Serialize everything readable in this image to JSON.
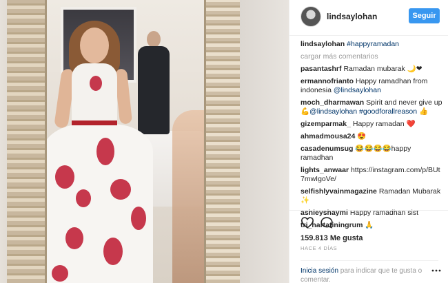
{
  "post": {
    "username": "lindsaylohan",
    "follow_label": "Seguir",
    "caption_user": "lindsaylohan",
    "caption_tag": "#happyramadan",
    "load_more": "cargar más comentarios",
    "comments": [
      {
        "user": "pasantashrf",
        "text": "Ramadan mubarak 🌙❤"
      },
      {
        "user": "ermannofrianto",
        "text": "Happy ramadhan from indonesia ",
        "tag": "@lindsaylohan"
      },
      {
        "user": "moch_dharmawan",
        "text": "Spirit and never give up 💪",
        "tag": "@lindsaylohan #goodforallreason",
        "after": " 👍"
      },
      {
        "user": "gizemparmak_",
        "text": "Happy ramadan ❤️"
      },
      {
        "user": "ahmadmousa24",
        "text": "😍"
      },
      {
        "user": "casadenumsug",
        "text": "😂😂😂😂happy ramadhan"
      },
      {
        "user": "lights_anwaar",
        "text": "https://instagram.com/p/BUt7mwIgoVe/"
      },
      {
        "user": "selfishlyvainmagazine",
        "text": "Ramadan Mubarak ✨"
      },
      {
        "user": "ashleyshaymi",
        "text": "Happy ramadhan sist"
      },
      {
        "user": "tri_hartatiningrum",
        "text": "🙏"
      }
    ],
    "likes": "159.813 Me gusta",
    "date": "HACE 4 DÍAS",
    "login_link": "Inicia sesión",
    "login_text": " para indicar que te gusta o comentar."
  },
  "icons": {
    "like": "heart-icon",
    "comment": "comment-bubble-icon",
    "more": "more-options-icon"
  },
  "colors": {
    "follow_button": "#3897f0",
    "link": "#003569",
    "muted": "#999999"
  }
}
